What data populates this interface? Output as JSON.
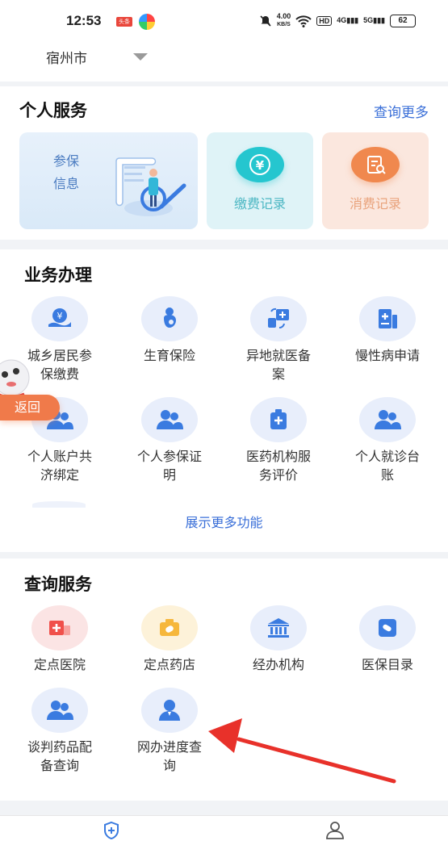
{
  "status_bar": {
    "time": "12:53",
    "app1_label": "头条",
    "speed_value": "4.00",
    "speed_unit": "KB/S",
    "hd": "HD",
    "sig1": "4G",
    "sig2": "5G",
    "battery": "62"
  },
  "city": {
    "name": "宿州市"
  },
  "personal_service": {
    "title": "个人服务",
    "more": "查询更多",
    "insure_label": "参保信息",
    "pay_label": "缴费记录",
    "spend_label": "消费记录",
    "pay_icon_glyph": "¥"
  },
  "business": {
    "title": "业务办理",
    "items": [
      {
        "label": "城乡居民参保缴费",
        "icon": "hand-yen-icon"
      },
      {
        "label": "生育保险",
        "icon": "pregnant-icon"
      },
      {
        "label": "异地就医备案",
        "icon": "transfer-hospital-icon"
      },
      {
        "label": "慢性病申请",
        "icon": "clipboard-plus-icon"
      },
      {
        "label": "个人账户共济绑定",
        "icon": "people-icon"
      },
      {
        "label": "个人参保证明",
        "icon": "people-icon"
      },
      {
        "label": "医药机构服务评价",
        "icon": "medical-box-icon"
      },
      {
        "label": "个人就诊台账",
        "icon": "people-icon"
      }
    ],
    "expand": "展示更多功能"
  },
  "query": {
    "title": "查询服务",
    "items": [
      {
        "label": "定点医院",
        "icon": "hospital-icon",
        "color": "#f0504b"
      },
      {
        "label": "定点药店",
        "icon": "pharmacy-icon",
        "color": "#f6b73b"
      },
      {
        "label": "经办机构",
        "icon": "institution-icon",
        "color": "#3a7be0"
      },
      {
        "label": "医保目录",
        "icon": "catalog-icon",
        "color": "#3a7be0"
      },
      {
        "label": "谈判药品配备查询",
        "icon": "people-icon",
        "color": "#3a7be0"
      },
      {
        "label": "网办进度查询",
        "icon": "person-icon",
        "color": "#3a7be0"
      }
    ]
  },
  "floating": {
    "back": "返回"
  },
  "colors": {
    "accent": "#3a6fd8",
    "arrow": "#e8312a"
  }
}
